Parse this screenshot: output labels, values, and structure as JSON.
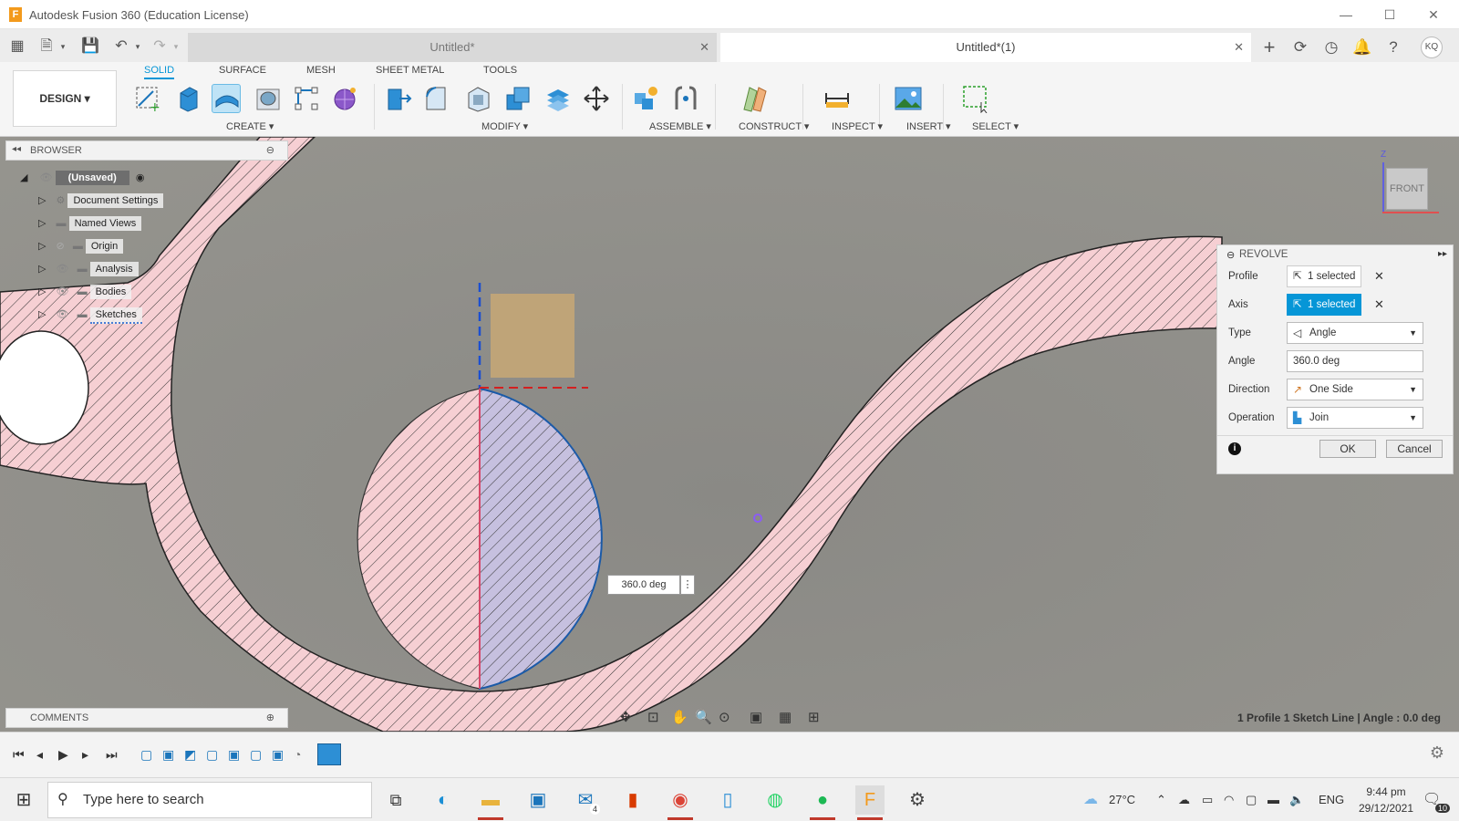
{
  "window": {
    "title": "Autodesk Fusion 360 (Education License)",
    "logo_letter": "F"
  },
  "tabs": [
    {
      "label": "Untitled*",
      "active": false
    },
    {
      "label": "Untitled*(1)",
      "active": true
    }
  ],
  "user": {
    "initials": "KQ"
  },
  "workspace": {
    "label": "DESIGN ▾"
  },
  "ribbon_tabs": [
    "SOLID",
    "SURFACE",
    "MESH",
    "SHEET METAL",
    "TOOLS"
  ],
  "ribbon_groups": {
    "create": "CREATE ▾",
    "modify": "MODIFY ▾",
    "assemble": "ASSEMBLE ▾",
    "construct": "CONSTRUCT ▾",
    "inspect": "INSPECT ▾",
    "insert": "INSERT ▾",
    "select": "SELECT ▾"
  },
  "browser": {
    "title": "BROWSER",
    "root": "(Unsaved)",
    "items": [
      "Document Settings",
      "Named Views",
      "Origin",
      "Analysis",
      "Bodies",
      "Sketches"
    ]
  },
  "comments": {
    "title": "COMMENTS"
  },
  "viewcube": {
    "face": "FRONT",
    "axis_z": "Z"
  },
  "angle_input": {
    "value": "360.0 deg"
  },
  "revolve": {
    "title": "REVOLVE",
    "profile_label": "Profile",
    "profile_value": "1 selected",
    "axis_label": "Axis",
    "axis_value": "1 selected",
    "type_label": "Type",
    "type_value": "Angle",
    "angle_label": "Angle",
    "angle_value": "360.0 deg",
    "direction_label": "Direction",
    "direction_value": "One Side",
    "operation_label": "Operation",
    "operation_value": "Join",
    "ok": "OK",
    "cancel": "Cancel"
  },
  "status_text": "1 Profile 1 Sketch Line | Angle : 0.0 deg",
  "taskbar": {
    "search_placeholder": "Type here to search",
    "weather": "27°C",
    "language": "ENG",
    "time": "9:44 pm",
    "date": "29/12/2021",
    "mail_badge": "4",
    "notif_badge": "10"
  },
  "colors": {
    "accent": "#0696d7",
    "hatch_fill": "#f6cfd3",
    "hatch_line": "#333333",
    "viewport": "#8d8c87"
  }
}
